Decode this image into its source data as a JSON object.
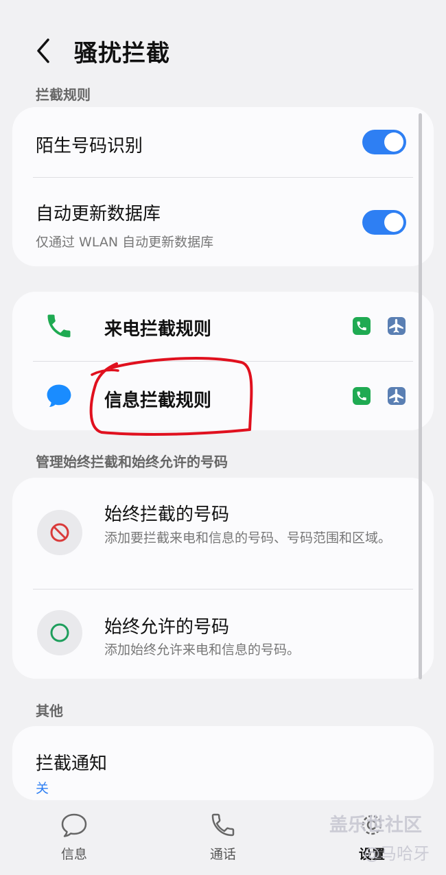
{
  "header": {
    "title": "骚扰拦截"
  },
  "sections": {
    "rules_label": "拦截规则",
    "manage_label": "管理始终拦截和始终允许的号码",
    "other_label": "其他"
  },
  "settings": {
    "unknown_number": {
      "label": "陌生号码识别",
      "enabled": true
    },
    "auto_update": {
      "label": "自动更新数据库",
      "sublabel": "仅通过 WLAN 自动更新数据库",
      "enabled": true
    }
  },
  "rules": [
    {
      "label": "来电拦截规则",
      "icon": "phone-icon"
    },
    {
      "label": "信息拦截规则",
      "icon": "message-bubble-icon"
    }
  ],
  "lists": [
    {
      "label": "始终拦截的号码",
      "sublabel": "添加要拦截来电和信息的号码、号码范围和区域。",
      "icon": "block-icon"
    },
    {
      "label": "始终允许的号码",
      "sublabel": "添加始终允许来电和信息的号码。",
      "icon": "allow-circle-icon"
    }
  ],
  "notification": {
    "label": "拦截通知",
    "value": "关"
  },
  "nav": [
    {
      "label": "信息",
      "icon": "chat-icon"
    },
    {
      "label": "通话",
      "icon": "phone-outline-icon"
    },
    {
      "label": "设置",
      "icon": "settings-icon"
    }
  ],
  "watermark": {
    "line1": "盖乐世社区",
    "line2": "@马哈牙"
  },
  "colors": {
    "accent": "#2e7ff3",
    "phone_green": "#1faa52",
    "block_red": "#d93a3a",
    "allow_green": "#1e9e5c",
    "annotation_red": "#e0101e"
  }
}
